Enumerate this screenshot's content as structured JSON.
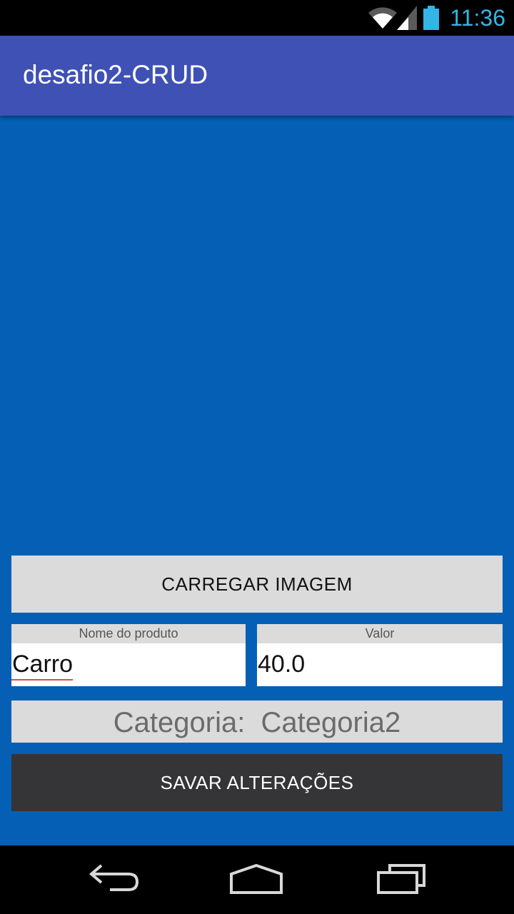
{
  "status_bar": {
    "time": "11:36",
    "icons": [
      "wifi-icon",
      "signal-icon",
      "battery-icon"
    ],
    "clock_color": "#33b5e5"
  },
  "app_bar": {
    "title": "desafio2-CRUD",
    "color": "#3f51b5"
  },
  "image_area": {
    "color": "#055fb5"
  },
  "form": {
    "load_image_label": "CARREGAR IMAGEM",
    "name_field": {
      "label": "Nome do produto",
      "value": "Carro"
    },
    "value_field": {
      "label": "Valor",
      "value": "40.0"
    },
    "category_text": "Categoria:  Categoria2",
    "save_label": "SAVAR ALTERAÇÕES"
  },
  "nav_bar": {
    "buttons": [
      "back-icon",
      "home-icon",
      "recents-icon"
    ]
  }
}
